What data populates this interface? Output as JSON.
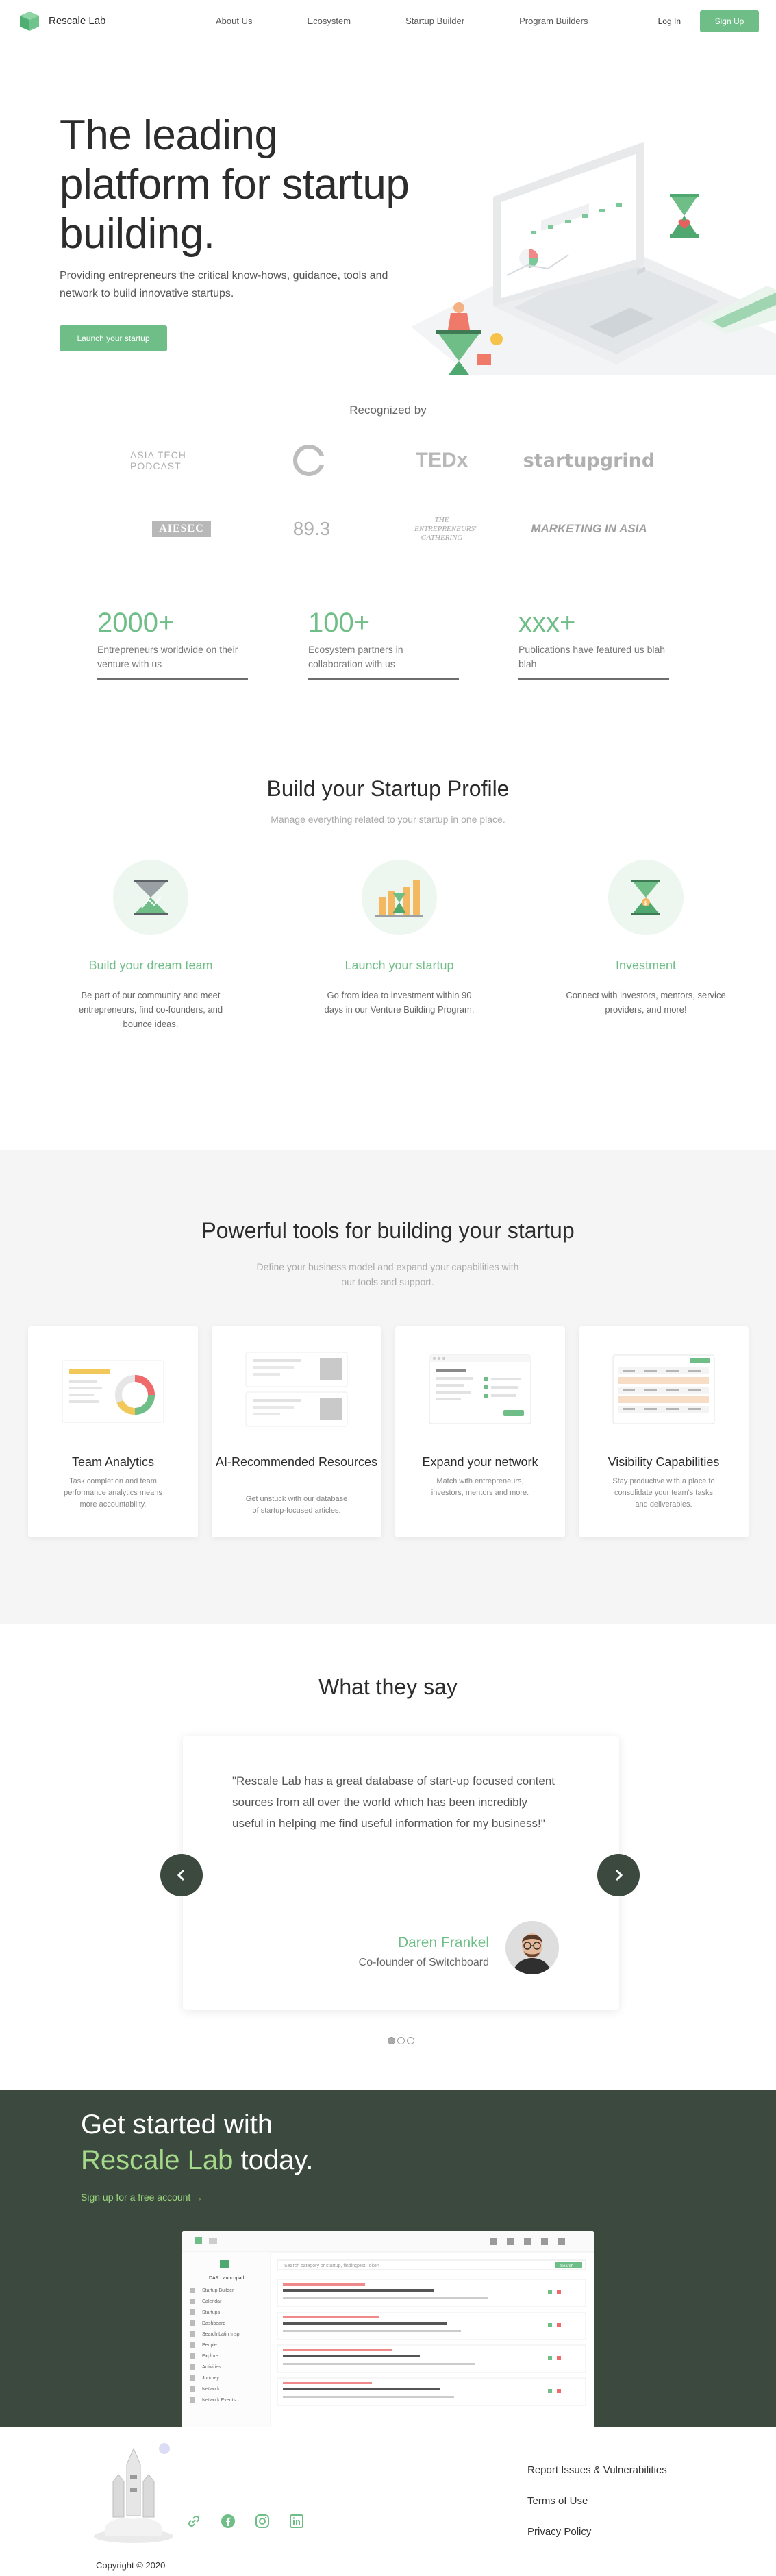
{
  "nav": {
    "brand": "Rescale Lab",
    "links": [
      "About Us",
      "Ecosystem",
      "Startup Builder",
      "Program Builders"
    ],
    "login": "Log In",
    "signup": "Sign Up"
  },
  "hero": {
    "title": "The leading platform for startup building.",
    "subtitle": "Providing entrepreneurs the critical know-hows, guidance, tools and network to build innovative startups.",
    "cta": "Launch your startup"
  },
  "recognized": {
    "heading": "Recognized by",
    "logos": [
      "ASIA TECH PODCAST",
      "",
      "TEDx",
      "startupgrind",
      "AIESEC",
      "89.3",
      "THE ENTREPRENEURS' GATHERING",
      "MARKETING IN ASIA"
    ]
  },
  "stats": [
    {
      "value": "2000+",
      "label": "Entrepreneurs worldwide on their venture with us"
    },
    {
      "value": "100+",
      "label": "Ecosystem partners in collaboration with us"
    },
    {
      "value": "xxx+",
      "label": "Publications have featured us blah blah"
    }
  ],
  "profile": {
    "heading": "Build your Startup Profile",
    "subheading": "Manage everything related to your startup in one place.",
    "features": [
      {
        "title": "Build your dream team",
        "desc": "Be part of our community and meet entrepreneurs, find co-founders, and bounce ideas."
      },
      {
        "title": "Launch your startup",
        "desc": "Go from idea to investment within 90 days in our Venture Building Program."
      },
      {
        "title": "Investment",
        "desc": "Connect with investors, mentors, service providers, and more!"
      }
    ]
  },
  "tools": {
    "heading": "Powerful tools for building your startup",
    "subheading": "Define your business model and expand your capabilities with our tools and support.",
    "cards": [
      {
        "title": "Team Analytics",
        "desc": "Task completion and team performance analytics means more accountability."
      },
      {
        "title": "AI-Recommended Resources",
        "desc": "Get unstuck with our database of startup-focused articles."
      },
      {
        "title": "Expand your network",
        "desc": "Match with entrepreneurs, investors, mentors and more."
      },
      {
        "title": "Visibility Capabilities",
        "desc": "Stay productive with a place to consolidate your team's tasks and deliverables."
      }
    ]
  },
  "testimonial": {
    "heading": "What they say",
    "quote": "\"Rescale Lab has a great database of start-up focused content sources from all over the world which has been incredibly useful in helping me find useful information for my business!\"",
    "name": "Daren Frankel",
    "role": "Co-founder of Switchboard",
    "slide_count": 3,
    "active_slide": 1
  },
  "cta": {
    "line1": "Get started with",
    "highlight": "Rescale Lab",
    "line2_rest": " today.",
    "link": "Sign up for a free account  →",
    "screenshot": {
      "search_placeholder": "Search category or startup, findingtest Token",
      "search_button": "Search",
      "team": "DAR Launchpad",
      "sidebar": [
        "Startup Builder",
        "Calendar",
        "Startups",
        "Dashboard",
        "Search Latin Inspi",
        "People",
        "Explore",
        "Activities",
        "Journey",
        "Network",
        "Network Events"
      ]
    }
  },
  "footer": {
    "copyright": "Copyright © 2020",
    "links": [
      "Report Issues & Vulnerabilities",
      "Terms of Use",
      "Privacy Policy"
    ]
  },
  "colors": {
    "accent": "#6fbe87",
    "dark": "#3c493e",
    "cta_highlight": "#a5d98a"
  }
}
